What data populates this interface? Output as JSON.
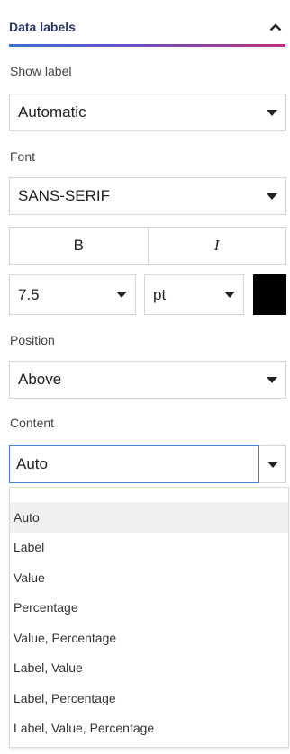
{
  "header": {
    "title": "Data labels",
    "toggle_icon": "chevron-up-icon",
    "accent_gradient": [
      "#3a6fd0",
      "#6a4fc4",
      "#c0317a"
    ]
  },
  "show_label": {
    "label": "Show label",
    "value": "Automatic"
  },
  "font": {
    "label": "Font",
    "family": "SANS-SERIF",
    "bold_label": "B",
    "italic_label": "I",
    "size": "7.5",
    "unit": "pt",
    "color": "#000000"
  },
  "position": {
    "label": "Position",
    "value": "Above"
  },
  "content": {
    "label": "Content",
    "value": "Auto",
    "options": [
      "Auto",
      "Label",
      "Value",
      "Percentage",
      "Value, Percentage",
      "Label, Value",
      "Label, Percentage",
      "Label, Value, Percentage"
    ],
    "highlighted_option": "Auto"
  }
}
